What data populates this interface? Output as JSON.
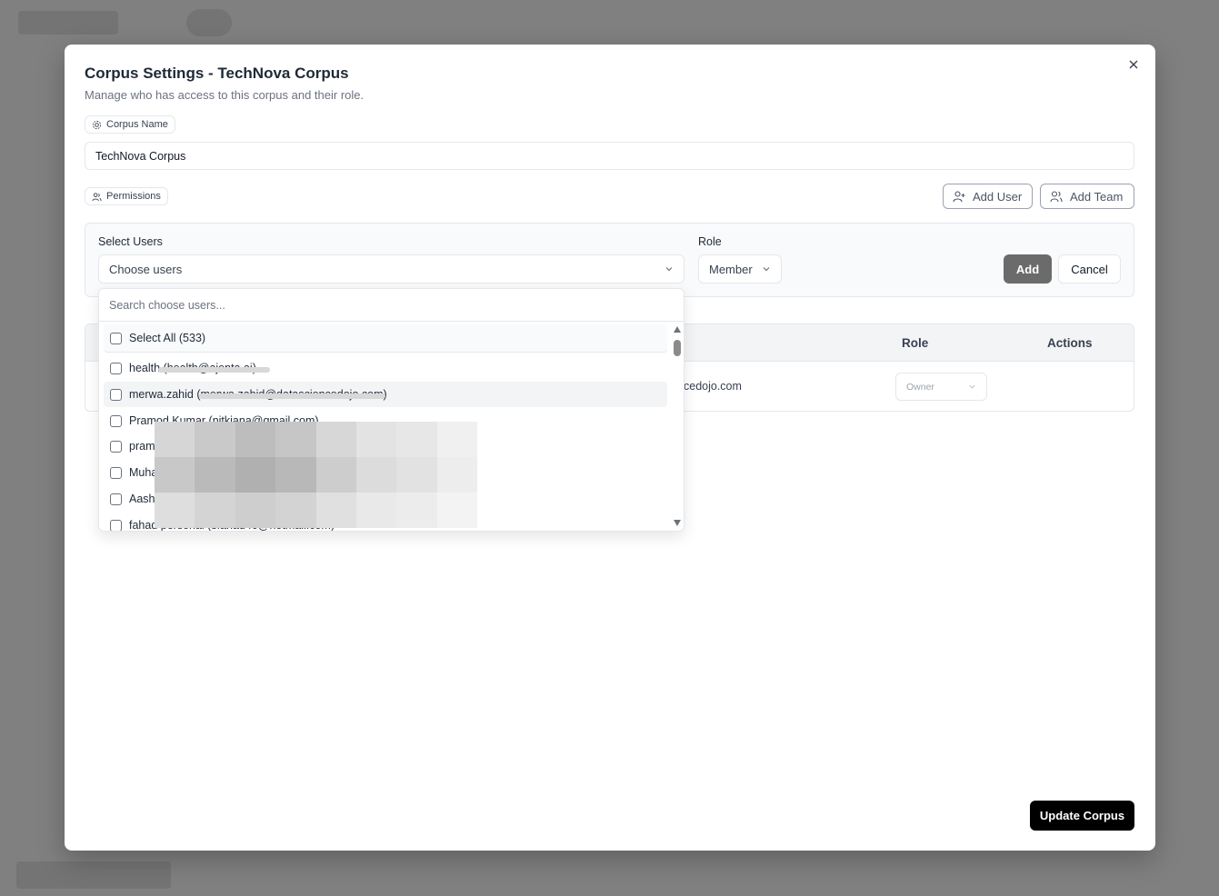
{
  "modal": {
    "title": "Corpus Settings - TechNova Corpus",
    "description": "Manage who has access to this corpus and their role.",
    "close_icon": "close-icon"
  },
  "corpus_name": {
    "label": "Corpus Name",
    "value": "TechNova Corpus"
  },
  "permissions": {
    "label": "Permissions",
    "add_user_label": "Add User",
    "add_team_label": "Add Team"
  },
  "select_users": {
    "label": "Select Users",
    "placeholder": "Choose users",
    "role_label": "Role",
    "role_value": "Member",
    "add_label": "Add",
    "cancel_label": "Cancel"
  },
  "dropdown": {
    "search_placeholder": "Search choose users...",
    "select_all": "Select All (533)",
    "items": [
      "health (health@ajenta.ai)",
      "merwa.zahid (merwa.zahid@datasciencedojo.com)",
      "Pramod Kumar (nitkiana@gmail.com)",
      "pram",
      "Muha",
      "Aash",
      "fahad personal (sfahad40@hotmail.com)"
    ]
  },
  "table": {
    "role_header": "Role",
    "actions_header": "Actions",
    "row_email_fragment": "cedojo.com",
    "row_role": "Owner"
  },
  "footer": {
    "update_label": "Update Corpus"
  },
  "colors": {
    "primary_button": "#000000",
    "add_button": "#6b6b6b",
    "overlay": "#808080"
  }
}
